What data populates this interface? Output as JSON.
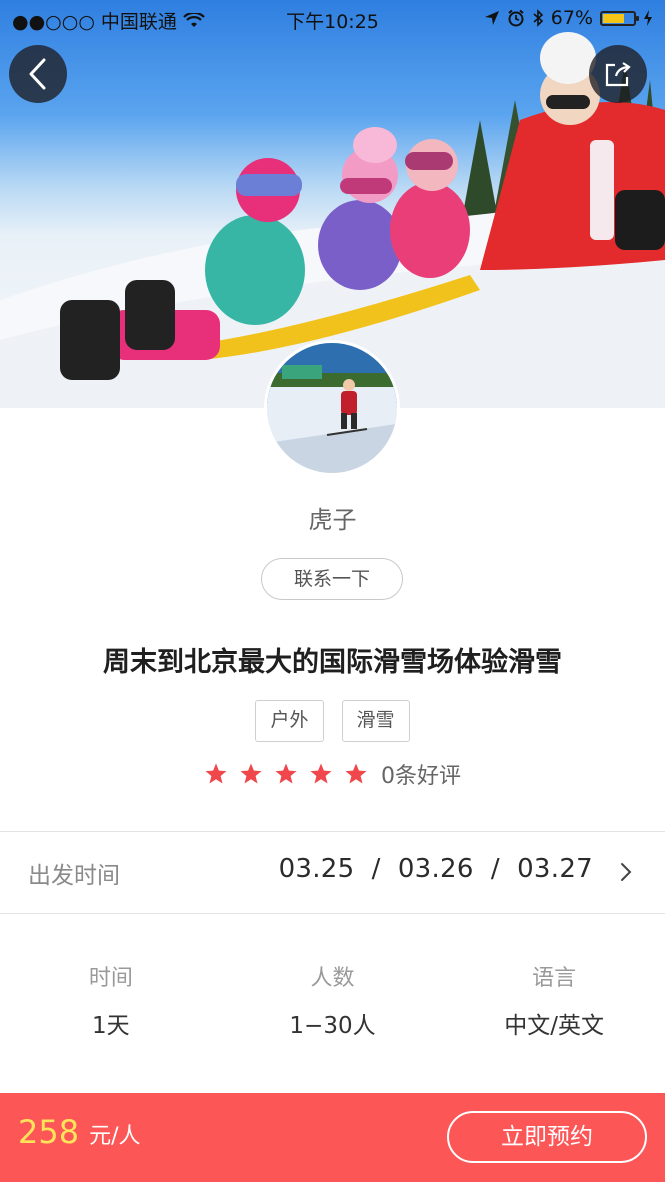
{
  "status_bar": {
    "carrier": "●●○○○ 中国联通",
    "time": "下午10:25",
    "battery_percent": "67%",
    "battery_level": 0.67
  },
  "icons": {
    "back": "chevron-left-icon",
    "share": "share-icon",
    "signal": "signal-dots-icon",
    "wifi": "wifi-icon",
    "location": "location-arrow-icon",
    "alarm": "alarm-icon",
    "bluetooth": "bluetooth-icon",
    "battery": "battery-icon",
    "charging": "charging-icon",
    "star": "star-icon",
    "chevron_right": "chevron-right-icon"
  },
  "guide": {
    "name": "虎子",
    "contact_label": "联系一下"
  },
  "activity": {
    "title": "周末到北京最大的国际滑雪场体验滑雪",
    "tags": [
      "户外",
      "滑雪"
    ],
    "rating_stars": 5,
    "review_count_text": "0条好评"
  },
  "departure": {
    "label": "出发时间",
    "dates_text": "03.25  /  03.26  /  03.27"
  },
  "details": [
    {
      "label": "时间",
      "value": "1天"
    },
    {
      "label": "人数",
      "value": "1−30人"
    },
    {
      "label": "语言",
      "value": "中文/英文"
    }
  ],
  "booking": {
    "price": "258",
    "unit": "元/人",
    "button_label": "立即预约"
  },
  "colors": {
    "accent_red": "#fc5657",
    "price_yellow": "#ffe35b",
    "star_red": "#f0474c",
    "battery_yellow": "#f5c518"
  }
}
